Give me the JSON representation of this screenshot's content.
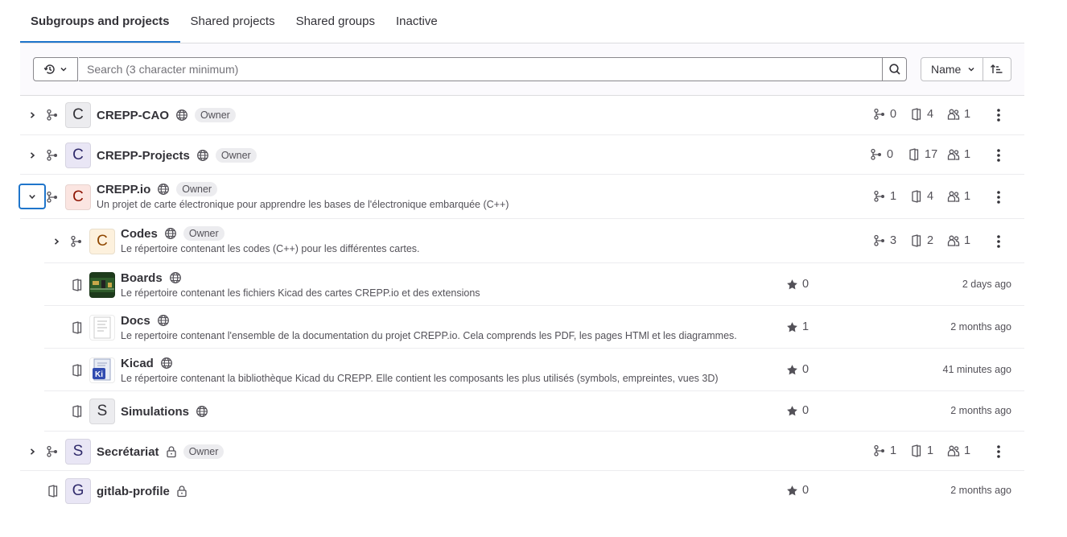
{
  "tabs": [
    {
      "label": "Subgroups and projects",
      "active": true
    },
    {
      "label": "Shared projects"
    },
    {
      "label": "Shared groups"
    },
    {
      "label": "Inactive"
    }
  ],
  "filter": {
    "search_placeholder": "Search (3 character minimum)",
    "sort_label": "Name"
  },
  "rows": [
    {
      "name": "CREPP-CAO",
      "letter": "C",
      "badge": "Owner",
      "visibility": "globe-icon",
      "subgroups": "0",
      "projects": "4",
      "members": "1"
    },
    {
      "name": "CREPP-Projects",
      "letter": "C",
      "badge": "Owner",
      "visibility": "globe-icon",
      "subgroups": "0",
      "projects": "17",
      "members": "1"
    },
    {
      "name": "CREPP.io",
      "letter": "C",
      "badge": "Owner",
      "visibility": "globe-icon",
      "desc": "Un projet de carte électronique pour apprendre les bases de l'électronique embarquée (C++)",
      "subgroups": "1",
      "projects": "4",
      "members": "1",
      "expanded": true
    },
    {
      "name": "Codes",
      "letter": "C",
      "badge": "Owner",
      "visibility": "globe-icon",
      "desc": "Le répertoire contenant les codes (C++) pour les différentes cartes.",
      "subgroups": "3",
      "projects": "2",
      "members": "1"
    },
    {
      "name": "Boards",
      "desc": "Le répertoire contenant les fichiers Kicad des cartes CREPP.io et des extensions",
      "stars": "0",
      "time": "2 days ago"
    },
    {
      "name": "Docs",
      "desc": "Le repertoire contenant l'ensemble de la documentation du projet CREPP.io. Cela comprends les PDF, les pages HTMl et les diagrammes.",
      "stars": "1",
      "time": "2 months ago"
    },
    {
      "name": "Kicad",
      "avatar_text": "Ki",
      "desc": "Le répertoire contenant la bibliothèque Kicad du CREPP. Elle contient les composants les plus utilisés (symbols, empreintes, vues 3D)",
      "stars": "0",
      "time": "41 minutes ago"
    },
    {
      "name": "Simulations",
      "letter": "S",
      "stars": "0",
      "time": "2 months ago"
    },
    {
      "name": "Secrétariat",
      "letter": "S",
      "badge": "Owner",
      "visibility": "lock-icon",
      "subgroups": "1",
      "projects": "1",
      "members": "1"
    },
    {
      "name": "gitlab-profile",
      "letter": "G",
      "visibility": "lock-icon",
      "stars": "0",
      "time": "2 months ago"
    }
  ],
  "colors": {
    "accent": "#1f75cb",
    "text": "#333238",
    "muted": "#535158"
  }
}
